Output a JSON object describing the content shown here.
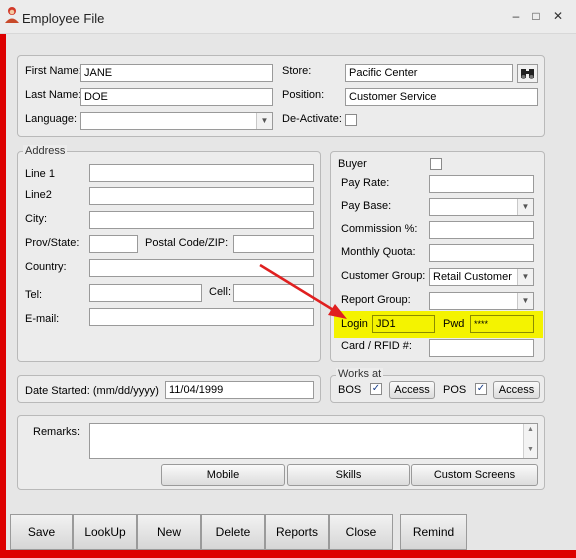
{
  "window": {
    "title": "Employee File",
    "minimize_glyph": "–",
    "maximize_glyph": "□",
    "close_glyph": "✕",
    "border_color": "#dd0000"
  },
  "top": {
    "first_name_label": "First Name:",
    "first_name_value": "JANE",
    "last_name_label": "Last Name:",
    "last_name_value": "DOE",
    "language_label": "Language:",
    "language_value": "",
    "store_label": "Store:",
    "store_value": "Pacific Center",
    "position_label": "Position:",
    "position_value": "Customer Service",
    "deactivate_label": "De-Activate:"
  },
  "address": {
    "legend": "Address",
    "line1_label": "Line 1",
    "line2_label": "Line2",
    "city_label": "City:",
    "prov_label": "Prov/State:",
    "postal_label": "Postal Code/ZIP:",
    "country_label": "Country:",
    "tel_label": "Tel:",
    "cell_label": "Cell:",
    "email_label": "E-mail:"
  },
  "pay": {
    "buyer_label": "Buyer",
    "pay_rate_label": "Pay Rate:",
    "pay_base_label": "Pay Base:",
    "commission_label": "Commission %:",
    "monthly_quota_label": "Monthly Quota:",
    "customer_group_label": "Customer Group:",
    "customer_group_value": "Retail Customer",
    "report_group_label": "Report Group:",
    "login_label": "Login",
    "login_value": "JD1",
    "pwd_label": "Pwd",
    "pwd_value": "****",
    "card_label": "Card / RFID #:"
  },
  "date_started": {
    "label": "Date Started: (mm/dd/yyyy)",
    "value": "11/04/1999"
  },
  "works_at": {
    "legend": "Works at",
    "bos_label": "BOS",
    "pos_label": "POS",
    "check_glyph": "✓",
    "access_label": "Access"
  },
  "remarks": {
    "label": "Remarks:"
  },
  "buttons": {
    "mobile": "Mobile",
    "skills": "Skills",
    "custom_screens": "Custom Screens"
  },
  "toolbar": {
    "save": "Save",
    "lookup": "LookUp",
    "new": "New",
    "delete": "Delete",
    "reports": "Reports",
    "close": "Close",
    "remind": "Remind"
  },
  "icons": {
    "binoculars": "binoculars-icon",
    "app": "employee-icon",
    "dropdown": "chevron-down-icon",
    "arrow": "red-arrow-annotation"
  },
  "colors": {
    "highlight": "#f4f300",
    "arrow": "#e02020"
  }
}
